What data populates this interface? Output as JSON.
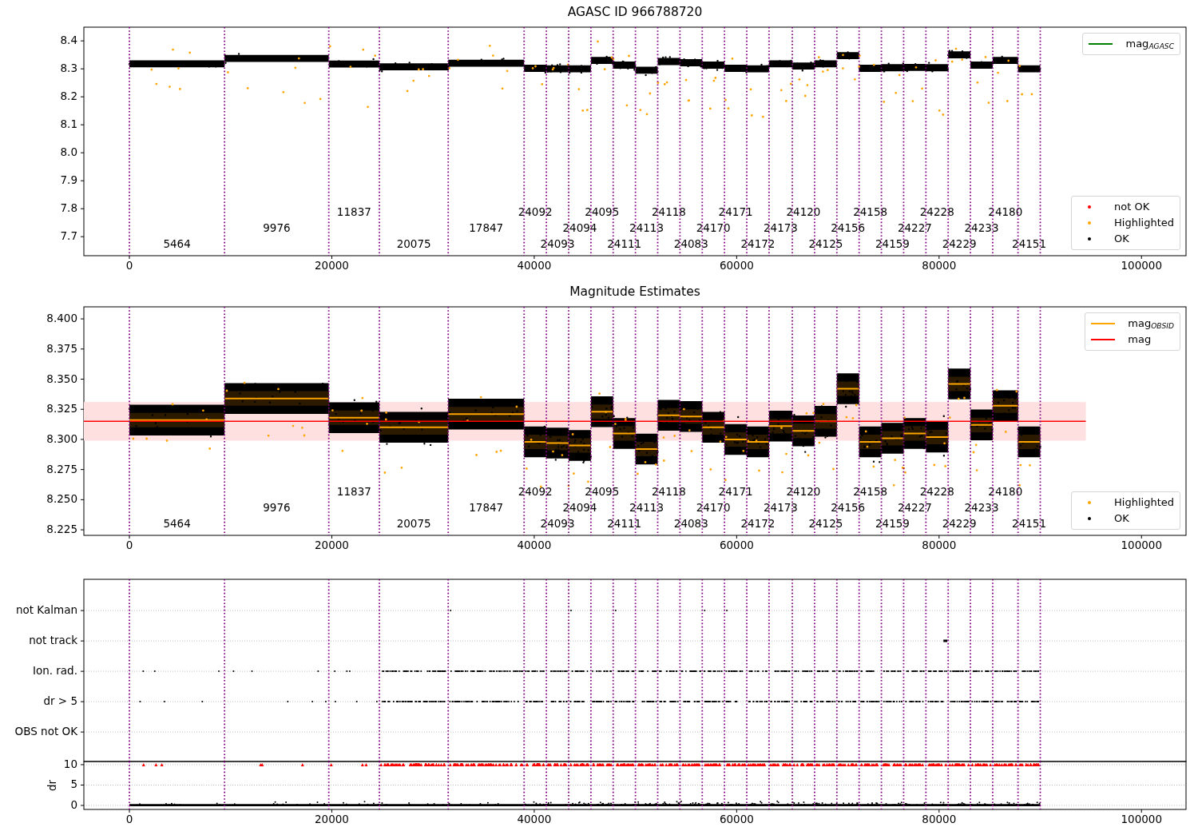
{
  "figure": {
    "panels": [
      {
        "kind": "magnitude",
        "chart_data": {
          "type": "scatter",
          "title": "AGASC ID 966788720",
          "xlim": [
            -4500,
            104400
          ],
          "ylim": [
            7.632,
            8.449
          ],
          "xticks": [
            0,
            20000,
            40000,
            60000,
            80000,
            100000
          ],
          "yticks": [
            {
              "value": 7.7,
              "label": "7.7"
            },
            {
              "value": 7.8,
              "label": "7.8"
            },
            {
              "value": 7.9,
              "label": "7.9"
            },
            {
              "value": 8.0,
              "label": "8.0"
            },
            {
              "value": 8.1,
              "label": "8.1"
            },
            {
              "value": 8.2,
              "label": "8.2"
            },
            {
              "value": 8.3,
              "label": "8.3"
            },
            {
              "value": 8.4,
              "label": "8.4"
            }
          ]
        },
        "obsid_labels": [
          "5464",
          "9976",
          "11837",
          "20075",
          "17847",
          "24092",
          "24093",
          "24094",
          "24095",
          "24111",
          "24113",
          "24118",
          "24083",
          "24170",
          "24171",
          "24172",
          "24173",
          "24120",
          "24125",
          "24156",
          "24158",
          "24159",
          "24227",
          "24228",
          "24229",
          "24233",
          "24180",
          "24151"
        ],
        "legends": [
          {
            "entries": [
              {
                "label": "mag$_{AGASC}$",
                "kind": "line",
                "color": "#008000"
              }
            ]
          },
          {
            "entries": [
              {
                "label": "not OK",
                "kind": "dot",
                "color": "#ff0000"
              },
              {
                "label": "Highlighted",
                "kind": "dot",
                "color": "#ffa500"
              },
              {
                "label": "OK",
                "kind": "dot",
                "color": "#000000"
              }
            ]
          }
        ]
      },
      {
        "kind": "estimates",
        "chart_data": {
          "type": "scatter",
          "title": "Magnitude Estimates",
          "xlim": [
            -4500,
            104400
          ],
          "ylim": [
            8.2204,
            8.41
          ],
          "xticks": [
            0,
            20000,
            40000,
            60000,
            80000,
            100000
          ],
          "yticks": [
            {
              "value": 8.225,
              "label": "8.225"
            },
            {
              "value": 8.25,
              "label": "8.250"
            },
            {
              "value": 8.275,
              "label": "8.275"
            },
            {
              "value": 8.3,
              "label": "8.300"
            },
            {
              "value": 8.325,
              "label": "8.325"
            },
            {
              "value": 8.35,
              "label": "8.350"
            },
            {
              "value": 8.375,
              "label": "8.375"
            },
            {
              "value": 8.4,
              "label": "8.400"
            }
          ]
        },
        "obsid_labels": [
          "5464",
          "9976",
          "11837",
          "20075",
          "17847",
          "24092",
          "24093",
          "24094",
          "24095",
          "24111",
          "24113",
          "24118",
          "24083",
          "24170",
          "24171",
          "24172",
          "24173",
          "24120",
          "24125",
          "24156",
          "24158",
          "24159",
          "24227",
          "24228",
          "24229",
          "24233",
          "24180",
          "24151"
        ],
        "legends": [
          {
            "entries": [
              {
                "label": "mag$_{OBSID}$",
                "kind": "line",
                "color": "#ffa500"
              },
              {
                "label": "mag",
                "kind": "line",
                "color": "#ff0000"
              }
            ]
          },
          {
            "entries": [
              {
                "label": "Highlighted",
                "kind": "dot",
                "color": "#ffa500"
              },
              {
                "label": "OK",
                "kind": "dot",
                "color": "#000000"
              }
            ]
          }
        ]
      },
      {
        "kind": "flags",
        "chart_data": {
          "type": "scatter",
          "orientation": "horizontal",
          "xlim": [
            -4500,
            104400
          ],
          "grid": true,
          "categories": [
            "not Kalman",
            "not track",
            "Ion. rad.",
            "dr > 5",
            "OBS not OK"
          ]
        }
      },
      {
        "kind": "dr",
        "chart_data": {
          "type": "scatter",
          "ylabel": "dr",
          "xlim": [
            -4500,
            104400
          ],
          "ylim": [
            -0.98,
            10.78
          ],
          "grid": true,
          "xticks": [
            0,
            20000,
            40000,
            60000,
            80000,
            100000
          ],
          "yticks": [
            0,
            5,
            10
          ]
        }
      }
    ]
  }
}
